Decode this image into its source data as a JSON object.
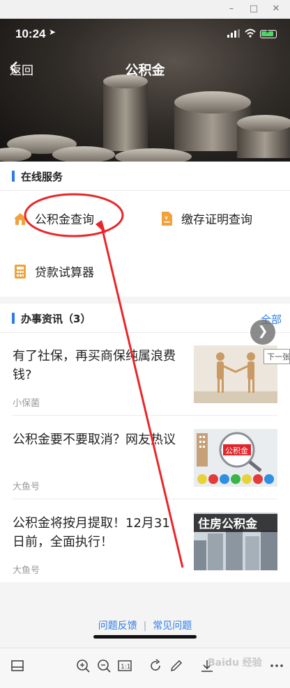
{
  "window": {
    "min_icon": "minimize-icon",
    "max_icon": "maximize-icon",
    "close_icon": "close-icon"
  },
  "status_bar": {
    "time": "10:24"
  },
  "nav": {
    "back_label": "返回",
    "title": "公积金"
  },
  "online_services": {
    "title": "在线服务",
    "items": [
      {
        "label": "公积金查询",
        "icon": "house-icon"
      },
      {
        "label": "缴存证明查询",
        "icon": "document-icon"
      },
      {
        "label": "贷款试算器",
        "icon": "calculator-icon"
      }
    ]
  },
  "news_section": {
    "title": "办事资讯（3）",
    "more_label": "全部",
    "next_tooltip": "下一张",
    "items": [
      {
        "title": "有了社保，再买商保纯属浪费钱?",
        "source": "小保菌"
      },
      {
        "title": "公积金要不要取消？网友热议",
        "source": "大鱼号"
      },
      {
        "title": "公积金将按月提取！12月31日前，全面执行！",
        "source": "大鱼号"
      }
    ]
  },
  "footer": {
    "feedback": "问题反馈",
    "faq": "常见问题"
  },
  "thumb_text": {
    "gjj_badge": "公积金",
    "banner": "住房公积金"
  },
  "watermark": "Baidu 经验",
  "colors": {
    "accent": "#2f7ce6",
    "annotation": "#e8262a"
  }
}
